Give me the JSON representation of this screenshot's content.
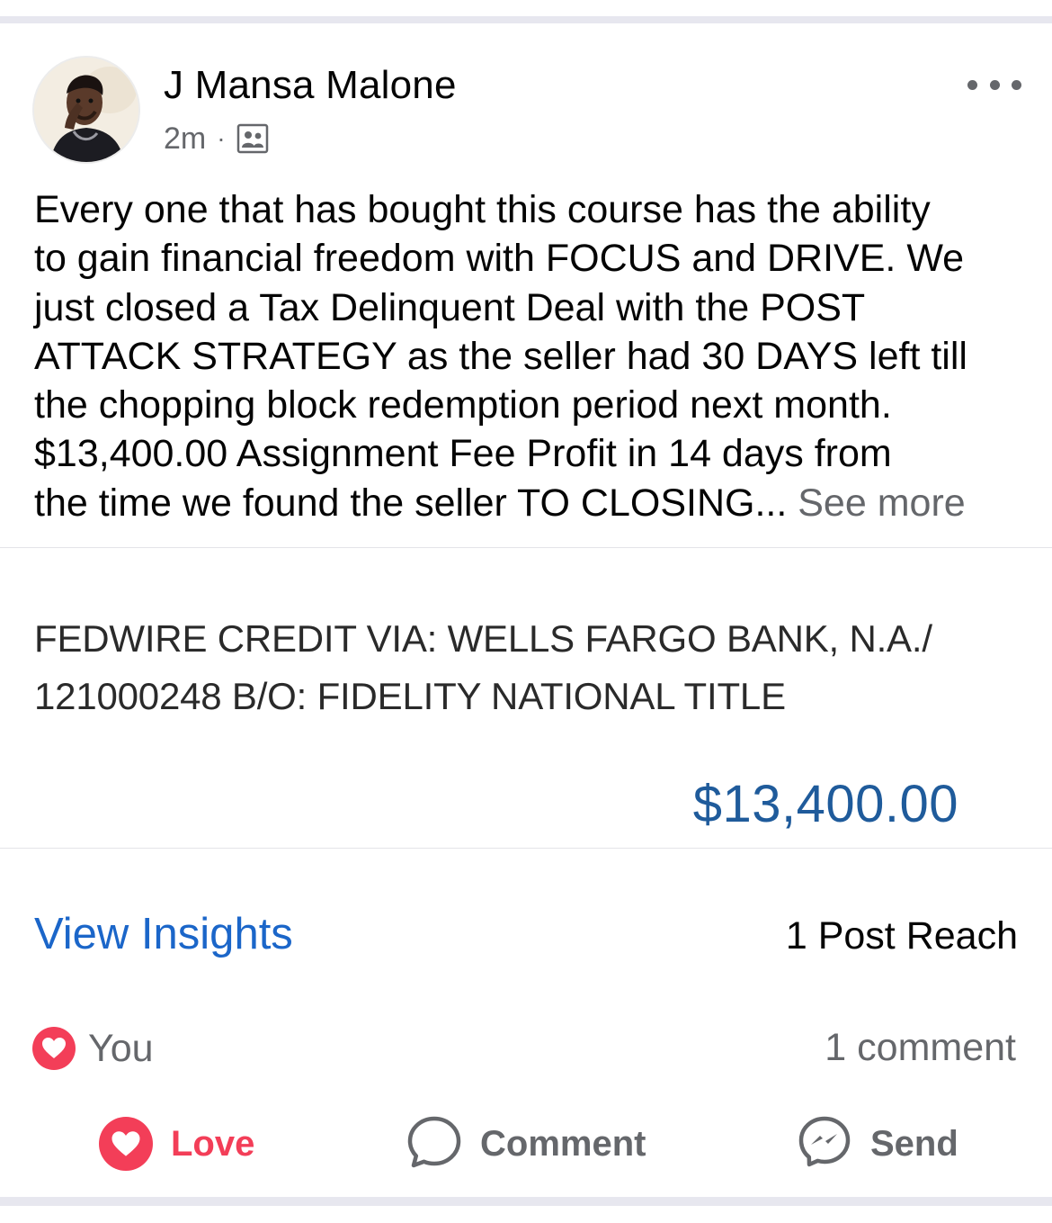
{
  "post": {
    "author": "J Mansa Malone",
    "time": "2m",
    "separator": "·",
    "audience_icon": "friends-group-icon",
    "text_lines": [
      "Every one that has bought this course has the ability",
      "to gain financial freedom with FOCUS and DRIVE. We",
      "just closed a Tax Delinquent Deal with the POST",
      "ATTACK STRATEGY as the seller had 30 DAYS left till",
      "the chopping block redemption period next month.",
      "$13,400.00 Assignment Fee Profit in 14 days from",
      "the time we found the seller TO CLOSING..."
    ],
    "see_more": "See more"
  },
  "attachment": {
    "line1": "FEDWIRE CREDIT VIA: WELLS FARGO BANK, N.A./",
    "line2": "121000248 B/O: FIDELITY NATIONAL TITLE",
    "amount": "$13,400.00",
    "amount_color": "#1f5b9b"
  },
  "insights": {
    "link_label": "View Insights",
    "reach": "1 Post Reach",
    "link_color": "#1b66c9"
  },
  "reactions": {
    "icon": "heart-icon",
    "by": "You",
    "comments": "1 comment"
  },
  "actions": {
    "love": "Love",
    "comment": "Comment",
    "send": "Send"
  },
  "colors": {
    "love": "#f33e58",
    "secondary_text": "#65676b",
    "band": "#e7e7ef"
  }
}
